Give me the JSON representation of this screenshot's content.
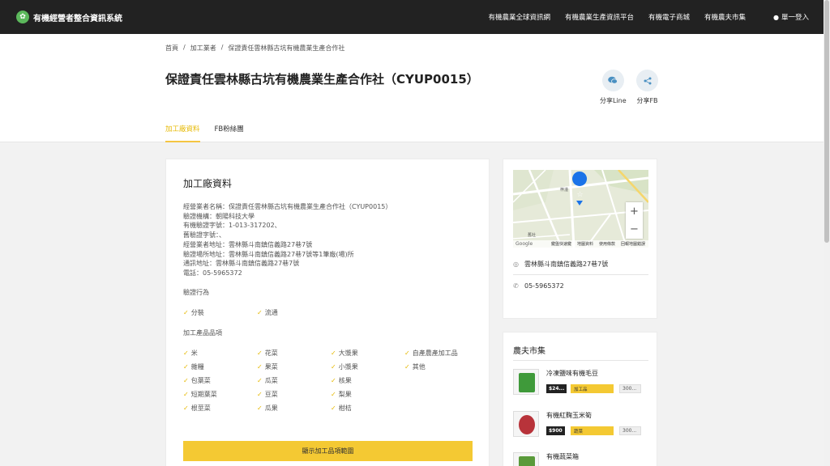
{
  "brand": {
    "name": "有機經營者整合資訊系統",
    "accent": "#f4c933",
    "green": "#5cb85c"
  },
  "nav": {
    "items": [
      "有機農業全球資訊網",
      "有機農業生產資訊平台",
      "有機電子商城",
      "有機農夫市集"
    ],
    "login": "單一登入"
  },
  "breadcrumb": [
    "首頁",
    "加工業者",
    "保證責任雲林縣古坑有機農業生產合作社"
  ],
  "title": "保證責任雲林縣古坑有機農業生產合作社（CYUP0015）",
  "share": {
    "line": "分享Line",
    "fb": "分享FB"
  },
  "tabs": [
    "加工廠資料",
    "FB粉絲團"
  ],
  "factory": {
    "heading": "加工廠資料",
    "info": [
      "經營業者名稱：保證責任雲林縣古坑有機農業生產合作社（CYUP0015）",
      "驗證機構：朝陽科技大學",
      "有機驗證字號：1-013-317202、",
      "舊驗證字號：、",
      "經營業者地址：雲林縣斗南鎮信義路27巷7號",
      "驗證場所地址：雲林縣斗南鎮信義路27巷7號等1筆廠(場)所",
      "通訊地址：雲林縣斗南鎮信義路27巷7號",
      "電話：05-5965372"
    ],
    "cert_label": "驗證行為",
    "cert_items": [
      "分裝",
      "流通"
    ],
    "product_label": "加工產品品項",
    "product_items": [
      "米",
      "花菜",
      "大漿果",
      "自產農產加工品",
      "雜糧",
      "果菜",
      "小漿果",
      "其他",
      "包葉菜",
      "瓜菜",
      "核果",
      "",
      "短期葉菜",
      "豆菜",
      "梨果",
      "",
      "根莖菜",
      "瓜果",
      "柑桔",
      ""
    ],
    "button": "顯示加工品項範圍"
  },
  "map": {
    "road1": "梓潼",
    "road2": "舊社",
    "footer": [
      "鍵盤快速鍵",
      "地圖資料",
      "使用條款",
      "回報地圖錯誤"
    ],
    "google": "Google",
    "address": "雲林縣斗南鎮信義路27巷7號",
    "phone": "05-5965372"
  },
  "market": {
    "title": "農夫市集",
    "products": [
      {
        "name": "冷凍鹽味有機毛豆",
        "price": "$24...",
        "category": "加工品",
        "weight": "300...",
        "color": "#3f9a3a"
      },
      {
        "name": "有機紅麴玉米筍",
        "price": "$900",
        "category": "蔬菜",
        "weight": "300...",
        "color": "#b8333a"
      },
      {
        "name": "有機蔬菜箱",
        "price": "",
        "category": "",
        "weight": "",
        "color": "#5a9a3a"
      }
    ]
  }
}
